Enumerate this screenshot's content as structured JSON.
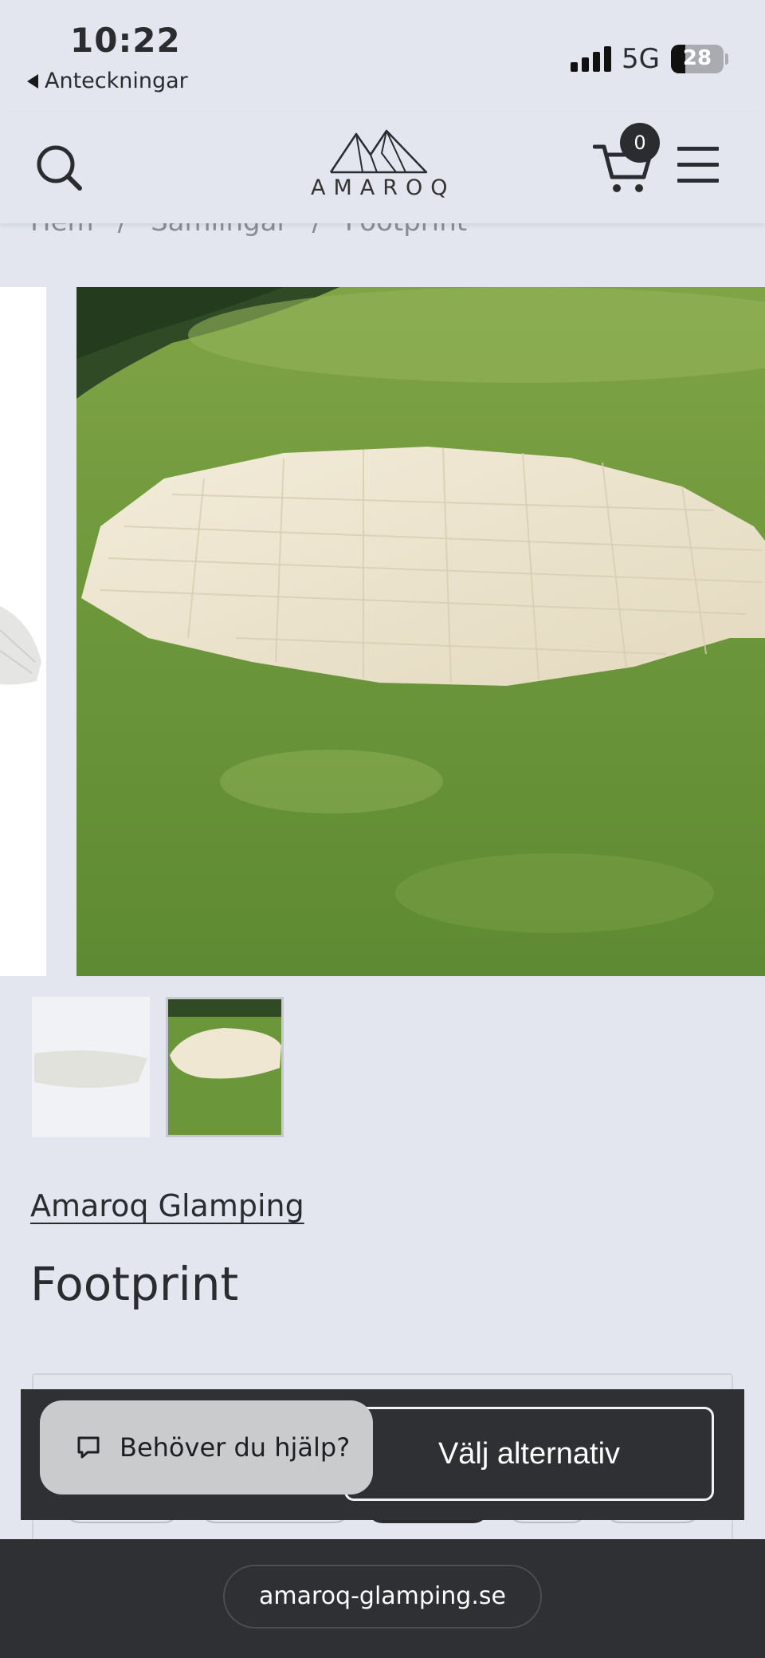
{
  "status_bar": {
    "time": "10:22",
    "back_app": "Anteckningar",
    "network": "5G",
    "battery": "28",
    "battery_level": 0.28
  },
  "header": {
    "logo_text": "AMAROQ",
    "cart_count": "0"
  },
  "breadcrumb": {
    "items": [
      "Hem",
      "/",
      "Samlingar",
      "/",
      "Footprint"
    ]
  },
  "product": {
    "vendor": "Amaroq Glamping",
    "title": "Footprint"
  },
  "actions": {
    "choose_label": "Välj alternativ",
    "help_label": "Behöver du hjälp?"
  },
  "browser": {
    "url": "amaroq-glamping.se"
  },
  "colors": {
    "page_bg": "#e3e6ee",
    "text": "#2a2c30",
    "sticky_bg": "#2f3033",
    "grass": "#6e9a3c",
    "tarp": "#ece4cf"
  }
}
